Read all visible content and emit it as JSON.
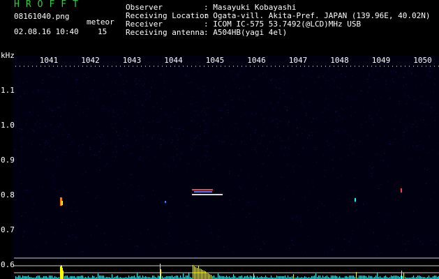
{
  "header": {
    "brand": "HROFFT",
    "filename": "08161040.png",
    "datetime": "02.08.16 10:40",
    "meteor_label": "meteor",
    "meteor_count": "15"
  },
  "info": [
    {
      "label": "Observer",
      "value": ": Masayuki Kobayashi"
    },
    {
      "label": "Receiving Location",
      "value": ": Ogata-vill. Akita-Pref. JAPAN (139.96E, 40.02N)"
    },
    {
      "label": "Receiver",
      "value": ": ICOM IC-575 53.7492(@LCD)MHz USB"
    },
    {
      "label": "Receiving antenna",
      "value": ": A504HB(yagi 4el)"
    }
  ],
  "plot": {
    "y_unit": "kHz",
    "x_ticks": [
      "1041",
      "1042",
      "1043",
      "1044",
      "1045",
      "1046",
      "1047",
      "1048",
      "1049",
      "1050"
    ],
    "y_ticks": [
      "1.1",
      "1.0",
      "0.9",
      "0.8",
      "0.7",
      "0.6"
    ],
    "colors": {
      "background": "#000010",
      "noise": "#1c1c7a",
      "echo": "#ff3b3b",
      "bar_high": "#ffff00",
      "bar_low": "#00ffff",
      "grid": "#ffffff"
    }
  }
}
